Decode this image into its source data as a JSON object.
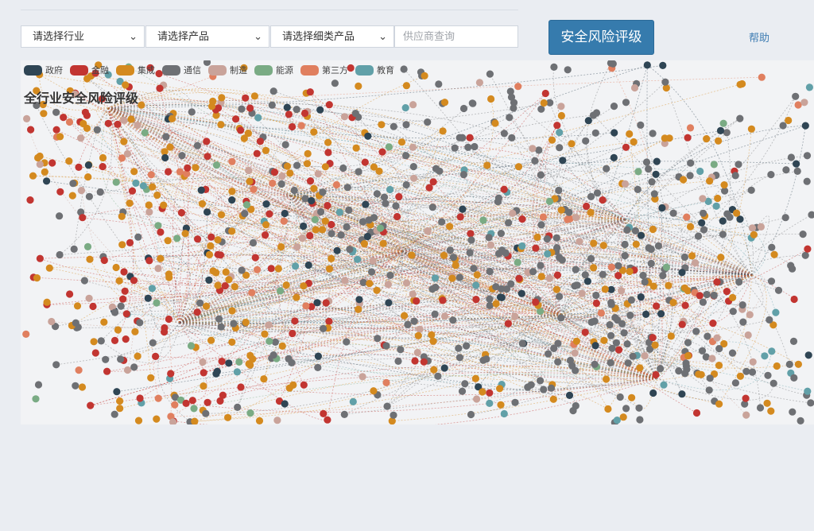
{
  "filters": {
    "industry_label": "请选择行业",
    "product_label": "请选择产品",
    "subproduct_label": "请选择细类产品",
    "vendor_placeholder": "供应商查询"
  },
  "actions": {
    "risk_button_label": "安全风险评级",
    "help_label": "帮助"
  },
  "graph": {
    "title": "全行业安全风险评级",
    "legend": [
      {
        "label": "政府",
        "color": "#2f4554"
      },
      {
        "label": "金融",
        "color": "#c23531"
      },
      {
        "label": "集成",
        "color": "#d48a1f"
      },
      {
        "label": "通信",
        "color": "#6e7074"
      },
      {
        "label": "制造",
        "color": "#c9a39a"
      },
      {
        "label": "能源",
        "color": "#7aab84"
      },
      {
        "label": "第三方",
        "color": "#e07f5f"
      },
      {
        "label": "教育",
        "color": "#61a0a8"
      }
    ]
  }
}
